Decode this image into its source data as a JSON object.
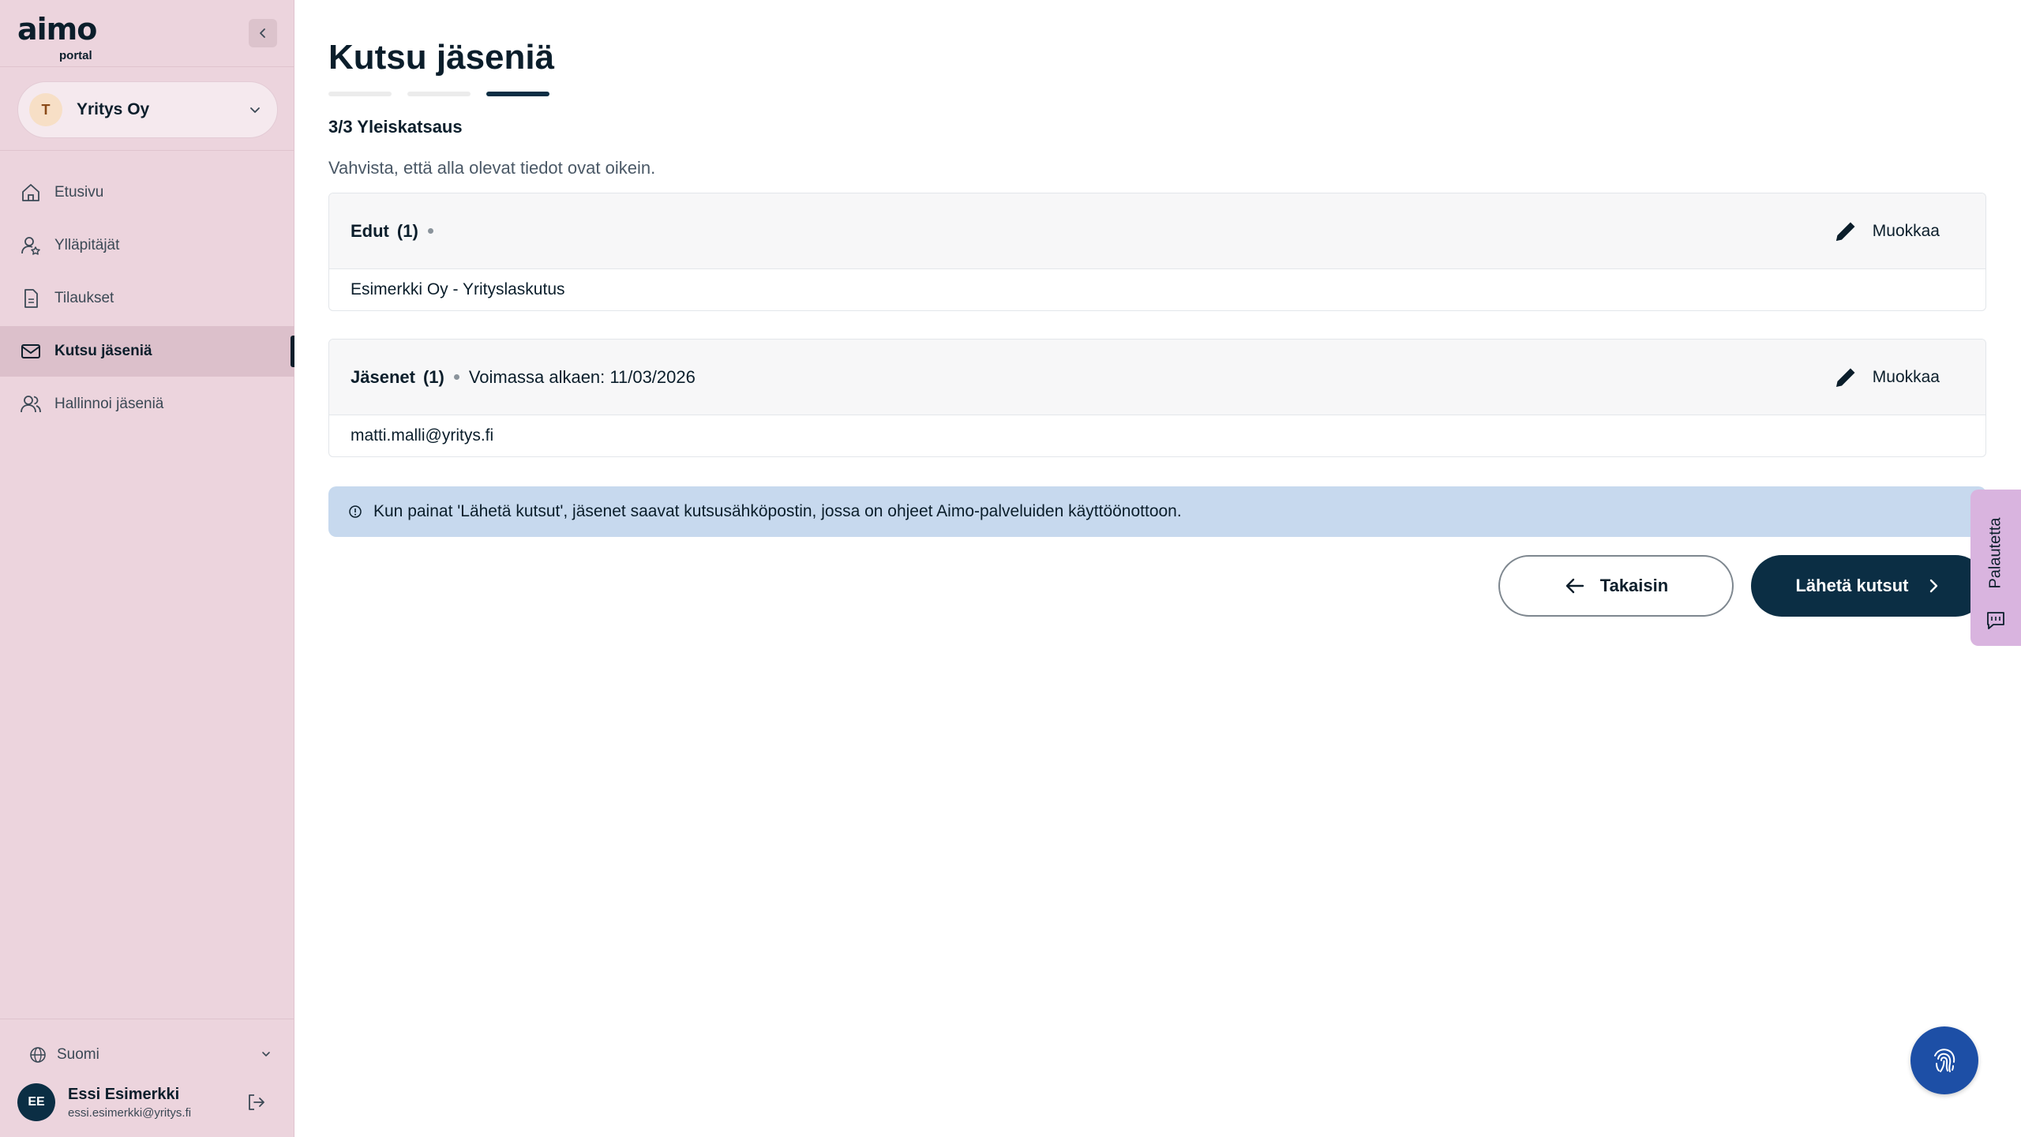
{
  "brand": {
    "name": "aimo",
    "sub": "portal"
  },
  "company": {
    "initial": "T",
    "name": "Yritys Oy"
  },
  "sidebar": {
    "items": [
      {
        "label": "Etusivu",
        "icon": "home-icon"
      },
      {
        "label": "Ylläpitäjät",
        "icon": "admin-user-icon"
      },
      {
        "label": "Tilaukset",
        "icon": "document-icon"
      },
      {
        "label": "Kutsu jäseniä",
        "icon": "mail-icon",
        "active": true
      },
      {
        "label": "Hallinnoi jäseniä",
        "icon": "users-icon"
      }
    ],
    "language": "Suomi"
  },
  "user": {
    "initials": "EE",
    "name": "Essi Esimerkki",
    "email": "essi.esimerkki@yritys.fi"
  },
  "main": {
    "title": "Kutsu jäseniä",
    "steps": {
      "total": 3,
      "current": 3
    },
    "step_title": "3/3 Yleiskatsaus",
    "subtitle": "Vahvista, että alla olevat tiedot ovat oikein.",
    "cards": [
      {
        "title": "Edut",
        "count": "(1)",
        "meta": "",
        "edit_label": "Muokkaa",
        "body": "Esimerkki Oy - Yrityslaskutus"
      },
      {
        "title": "Jäsenet",
        "count": "(1)",
        "meta": "Voimassa alkaen: 11/03/2026",
        "edit_label": "Muokkaa",
        "body": "matti.malli@yritys.fi"
      }
    ],
    "info": "Kun painat 'Lähetä kutsut', jäsenet saavat kutsusähköpostin, jossa on ohjeet Aimo-palveluiden käyttöönottoon.",
    "back_label": "Takaisin",
    "send_label": "Lähetä kutsut"
  },
  "feedback": {
    "label": "Palautetta"
  },
  "colors": {
    "sidebar_bg": "#ecd4dd",
    "primary": "#0b2e44",
    "info_bg": "#c7d9ee",
    "fab": "#1d4fa6",
    "feedback_bg": "#d9b4df"
  }
}
